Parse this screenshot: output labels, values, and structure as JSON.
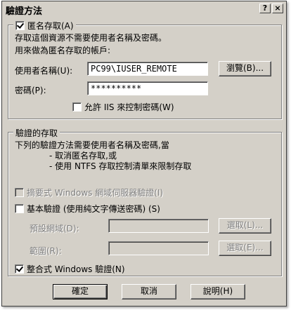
{
  "window": {
    "title": "驗證方法",
    "help_icon": "?",
    "close_icon": "×"
  },
  "anonymous": {
    "label": "匿名存取(A)",
    "checked": true,
    "desc1": "存取這個資源不需要使用者名稱及密碼。",
    "desc2": "用來做為匿名存取的帳戶:",
    "username_label": "使用者名稱(U):",
    "username_value": "PC99\\IUSER_REMOTE",
    "browse_label": "瀏覽(B)...",
    "password_label": "密碼(P):",
    "password_value": "**********",
    "allow_iis_label": "允許 IIS 來控制密碼(W)"
  },
  "auth": {
    "legend": "驗證的存取",
    "desc1": "下列的驗證方法需要使用者名稱及密碼,當",
    "desc2": "- 取消匿名存取,或",
    "desc3": "- 使用 NTFS 存取控制清單來限制存取",
    "digest_label": "摘要式 Windows 網域伺服器驗證(I)",
    "basic_label": "基本驗證 (使用純文字傳送密碼) (S)",
    "default_domain_label": "預設網域(D):",
    "select_label_1": "選取(L)...",
    "realm_label": "範圍(R):",
    "select_label_2": "選取(E)...",
    "integrated_label": "整合式 Windows 驗證(N)"
  },
  "footer": {
    "ok": "確定",
    "cancel": "取消",
    "help": "說明(H)"
  }
}
